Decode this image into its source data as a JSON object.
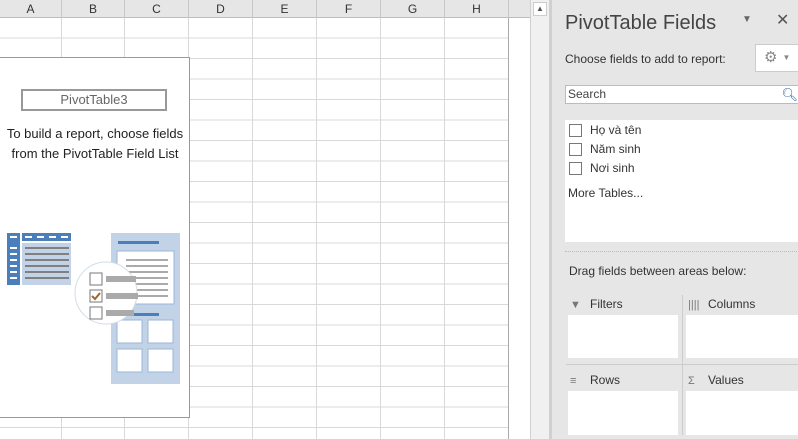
{
  "sheet": {
    "columns": [
      "A",
      "B",
      "C",
      "D",
      "E",
      "F",
      "G",
      "H"
    ]
  },
  "pivot": {
    "name": "PivotTable3",
    "message": "To build a report, choose fields from the PivotTable Field List"
  },
  "panel": {
    "title": "PivotTable Fields",
    "choose_label": "Choose fields to add to report:",
    "search_placeholder": "Search",
    "fields": [
      {
        "label": "Họ và tên",
        "checked": false
      },
      {
        "label": "Năm sinh",
        "checked": false
      },
      {
        "label": "Nơi sinh",
        "checked": false
      }
    ],
    "more_tables": "More Tables...",
    "drag_label": "Drag fields between areas below:",
    "areas": {
      "filters": "Filters",
      "columns": "Columns",
      "rows": "Rows",
      "values": "Values"
    }
  }
}
